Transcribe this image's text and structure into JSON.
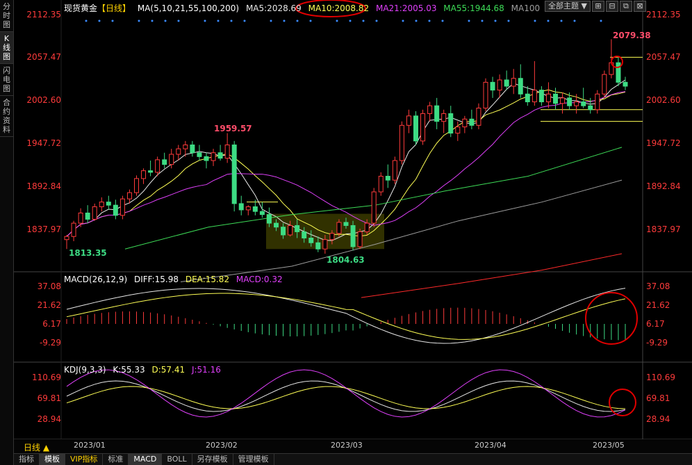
{
  "sidebar": {
    "tabs": [
      {
        "label": "分时图",
        "active": false
      },
      {
        "label": "K线图",
        "active": true
      },
      {
        "label": "闪电图",
        "active": false
      },
      {
        "label": "合约资料",
        "active": false
      }
    ]
  },
  "header": {
    "title": "现货黄金",
    "period": "【日线】",
    "ma_label": "MA(5,10,21,55,100,200)",
    "ma5": "MA5:2028.69",
    "ma10": "MA10:2008.82",
    "ma21": "MA21:2005.03",
    "ma55": "MA55:1944.68",
    "ma100": "MA100",
    "theme_button": "全部主题",
    "theme_dropdown_icon": "chevron-down-icon"
  },
  "colors": {
    "up": "#ff3b3b",
    "down": "#3ddc84",
    "ma5": "#e8e8e8",
    "ma10": "#ffff55",
    "ma21": "#e040fb",
    "ma55": "#3ddc57",
    "ma100": "#9e9e9e",
    "ma200": "#ff2a2a",
    "highlight": "#e00000"
  },
  "price_axis": {
    "labels": [
      "2112.35",
      "2057.47",
      "2002.60",
      "1947.72",
      "1892.84",
      "1837.97"
    ]
  },
  "annotations": {
    "high1": "1959.57",
    "low1": "1813.35",
    "low2": "1804.63",
    "high2": "2079.38"
  },
  "macd": {
    "label": "MACD(26,12,9)",
    "diff": "DIFF:15.98",
    "dea": "DEA:15.82",
    "macd": "MACD:0.32",
    "axis": [
      "37.08",
      "21.62",
      "6.17",
      "-9.29"
    ]
  },
  "kdj": {
    "label": "KDJ(9,3,3)",
    "k": "K:55.33",
    "d": "D:57.41",
    "j": "J:51.16",
    "axis": [
      "110.69",
      "69.81",
      "28.94"
    ]
  },
  "dates": [
    "2023/01",
    "2023/02",
    "2023/03",
    "2023/04",
    "2023/05"
  ],
  "period_selector": "日线",
  "period_arrow": "▲",
  "bottom_tabs": [
    {
      "label": "指标",
      "active": false
    },
    {
      "label": "模板",
      "active": true
    },
    {
      "label": "VIP指标",
      "active": false,
      "vip": true
    },
    {
      "label": "标准",
      "active": false
    },
    {
      "label": "MACD",
      "active": true
    },
    {
      "label": "BOLL",
      "active": false
    },
    {
      "label": "另存模板",
      "active": false
    },
    {
      "label": "管理模板",
      "active": false
    }
  ],
  "window_buttons": [
    "⊞",
    "⊟",
    "⧉",
    "⊠"
  ],
  "chart_data": {
    "type": "candlestick",
    "candles": [
      [
        1824,
        1830,
        1812,
        1828
      ],
      [
        1828,
        1848,
        1822,
        1845
      ],
      [
        1845,
        1864,
        1840,
        1858
      ],
      [
        1858,
        1868,
        1845,
        1850
      ],
      [
        1850,
        1870,
        1848,
        1866
      ],
      [
        1866,
        1878,
        1860,
        1872
      ],
      [
        1872,
        1880,
        1862,
        1868
      ],
      [
        1868,
        1875,
        1850,
        1855
      ],
      [
        1855,
        1880,
        1850,
        1876
      ],
      [
        1876,
        1888,
        1870,
        1884
      ],
      [
        1884,
        1906,
        1880,
        1902
      ],
      [
        1902,
        1915,
        1895,
        1912
      ],
      [
        1912,
        1925,
        1905,
        1910
      ],
      [
        1910,
        1930,
        1905,
        1926
      ],
      [
        1926,
        1935,
        1915,
        1920
      ],
      [
        1920,
        1940,
        1915,
        1933
      ],
      [
        1933,
        1945,
        1925,
        1940
      ],
      [
        1940,
        1950,
        1930,
        1945
      ],
      [
        1945,
        1950,
        1930,
        1935
      ],
      [
        1935,
        1945,
        1925,
        1930
      ],
      [
        1930,
        1935,
        1915,
        1925
      ],
      [
        1925,
        1940,
        1918,
        1935
      ],
      [
        1935,
        1945,
        1925,
        1928
      ],
      [
        1928,
        1960,
        1922,
        1945
      ],
      [
        1945,
        1950,
        1860,
        1870
      ],
      [
        1870,
        1880,
        1855,
        1862
      ],
      [
        1862,
        1868,
        1855,
        1866
      ],
      [
        1866,
        1875,
        1855,
        1860
      ],
      [
        1860,
        1872,
        1852,
        1856
      ],
      [
        1856,
        1865,
        1840,
        1845
      ],
      [
        1845,
        1850,
        1835,
        1840
      ],
      [
        1840,
        1845,
        1825,
        1830
      ],
      [
        1830,
        1848,
        1828,
        1842
      ],
      [
        1842,
        1850,
        1826,
        1834
      ],
      [
        1834,
        1840,
        1820,
        1826
      ],
      [
        1826,
        1836,
        1815,
        1820
      ],
      [
        1820,
        1828,
        1808,
        1812
      ],
      [
        1812,
        1830,
        1806,
        1824
      ],
      [
        1824,
        1836,
        1818,
        1832
      ],
      [
        1832,
        1850,
        1828,
        1846
      ],
      [
        1846,
        1852,
        1838,
        1842
      ],
      [
        1842,
        1848,
        1810,
        1815
      ],
      [
        1815,
        1838,
        1812,
        1834
      ],
      [
        1834,
        1850,
        1830,
        1845
      ],
      [
        1845,
        1890,
        1840,
        1885
      ],
      [
        1885,
        1910,
        1880,
        1905
      ],
      [
        1905,
        1920,
        1890,
        1900
      ],
      [
        1900,
        1930,
        1895,
        1925
      ],
      [
        1925,
        1975,
        1920,
        1970
      ],
      [
        1970,
        1990,
        1960,
        1982
      ],
      [
        1982,
        1988,
        1945,
        1950
      ],
      [
        1950,
        1990,
        1945,
        1985
      ],
      [
        1985,
        2000,
        1975,
        1995
      ],
      [
        1995,
        2005,
        1965,
        1975
      ],
      [
        1975,
        1990,
        1960,
        1985
      ],
      [
        1985,
        1995,
        1955,
        1960
      ],
      [
        1960,
        1975,
        1950,
        1968
      ],
      [
        1968,
        1982,
        1960,
        1978
      ],
      [
        1978,
        1990,
        1965,
        1970
      ],
      [
        1970,
        1998,
        1965,
        1992
      ],
      [
        1992,
        2030,
        1988,
        2025
      ],
      [
        2025,
        2032,
        2005,
        2015
      ],
      [
        2015,
        2035,
        2005,
        2028
      ],
      [
        2028,
        2040,
        2015,
        2020
      ],
      [
        2020,
        2042,
        2010,
        2030
      ],
      [
        2030,
        2048,
        2005,
        2010
      ],
      [
        2010,
        2020,
        1995,
        2000
      ],
      [
        2000,
        2052,
        1995,
        2015
      ],
      [
        2015,
        2020,
        1995,
        2000
      ],
      [
        2000,
        2025,
        1992,
        2010
      ],
      [
        2010,
        2018,
        1990,
        1998
      ],
      [
        1998,
        2012,
        1985,
        2005
      ],
      [
        2005,
        2012,
        1990,
        1995
      ],
      [
        1995,
        2010,
        1985,
        2000
      ],
      [
        2000,
        2018,
        1992,
        1995
      ],
      [
        1995,
        2005,
        1985,
        1990
      ],
      [
        1990,
        2015,
        1985,
        2010
      ],
      [
        2010,
        2040,
        2005,
        2035
      ],
      [
        2035,
        2080,
        2030,
        2050
      ],
      [
        2050,
        2058,
        2020,
        2025
      ],
      [
        2025,
        2032,
        2015,
        2020
      ]
    ]
  }
}
